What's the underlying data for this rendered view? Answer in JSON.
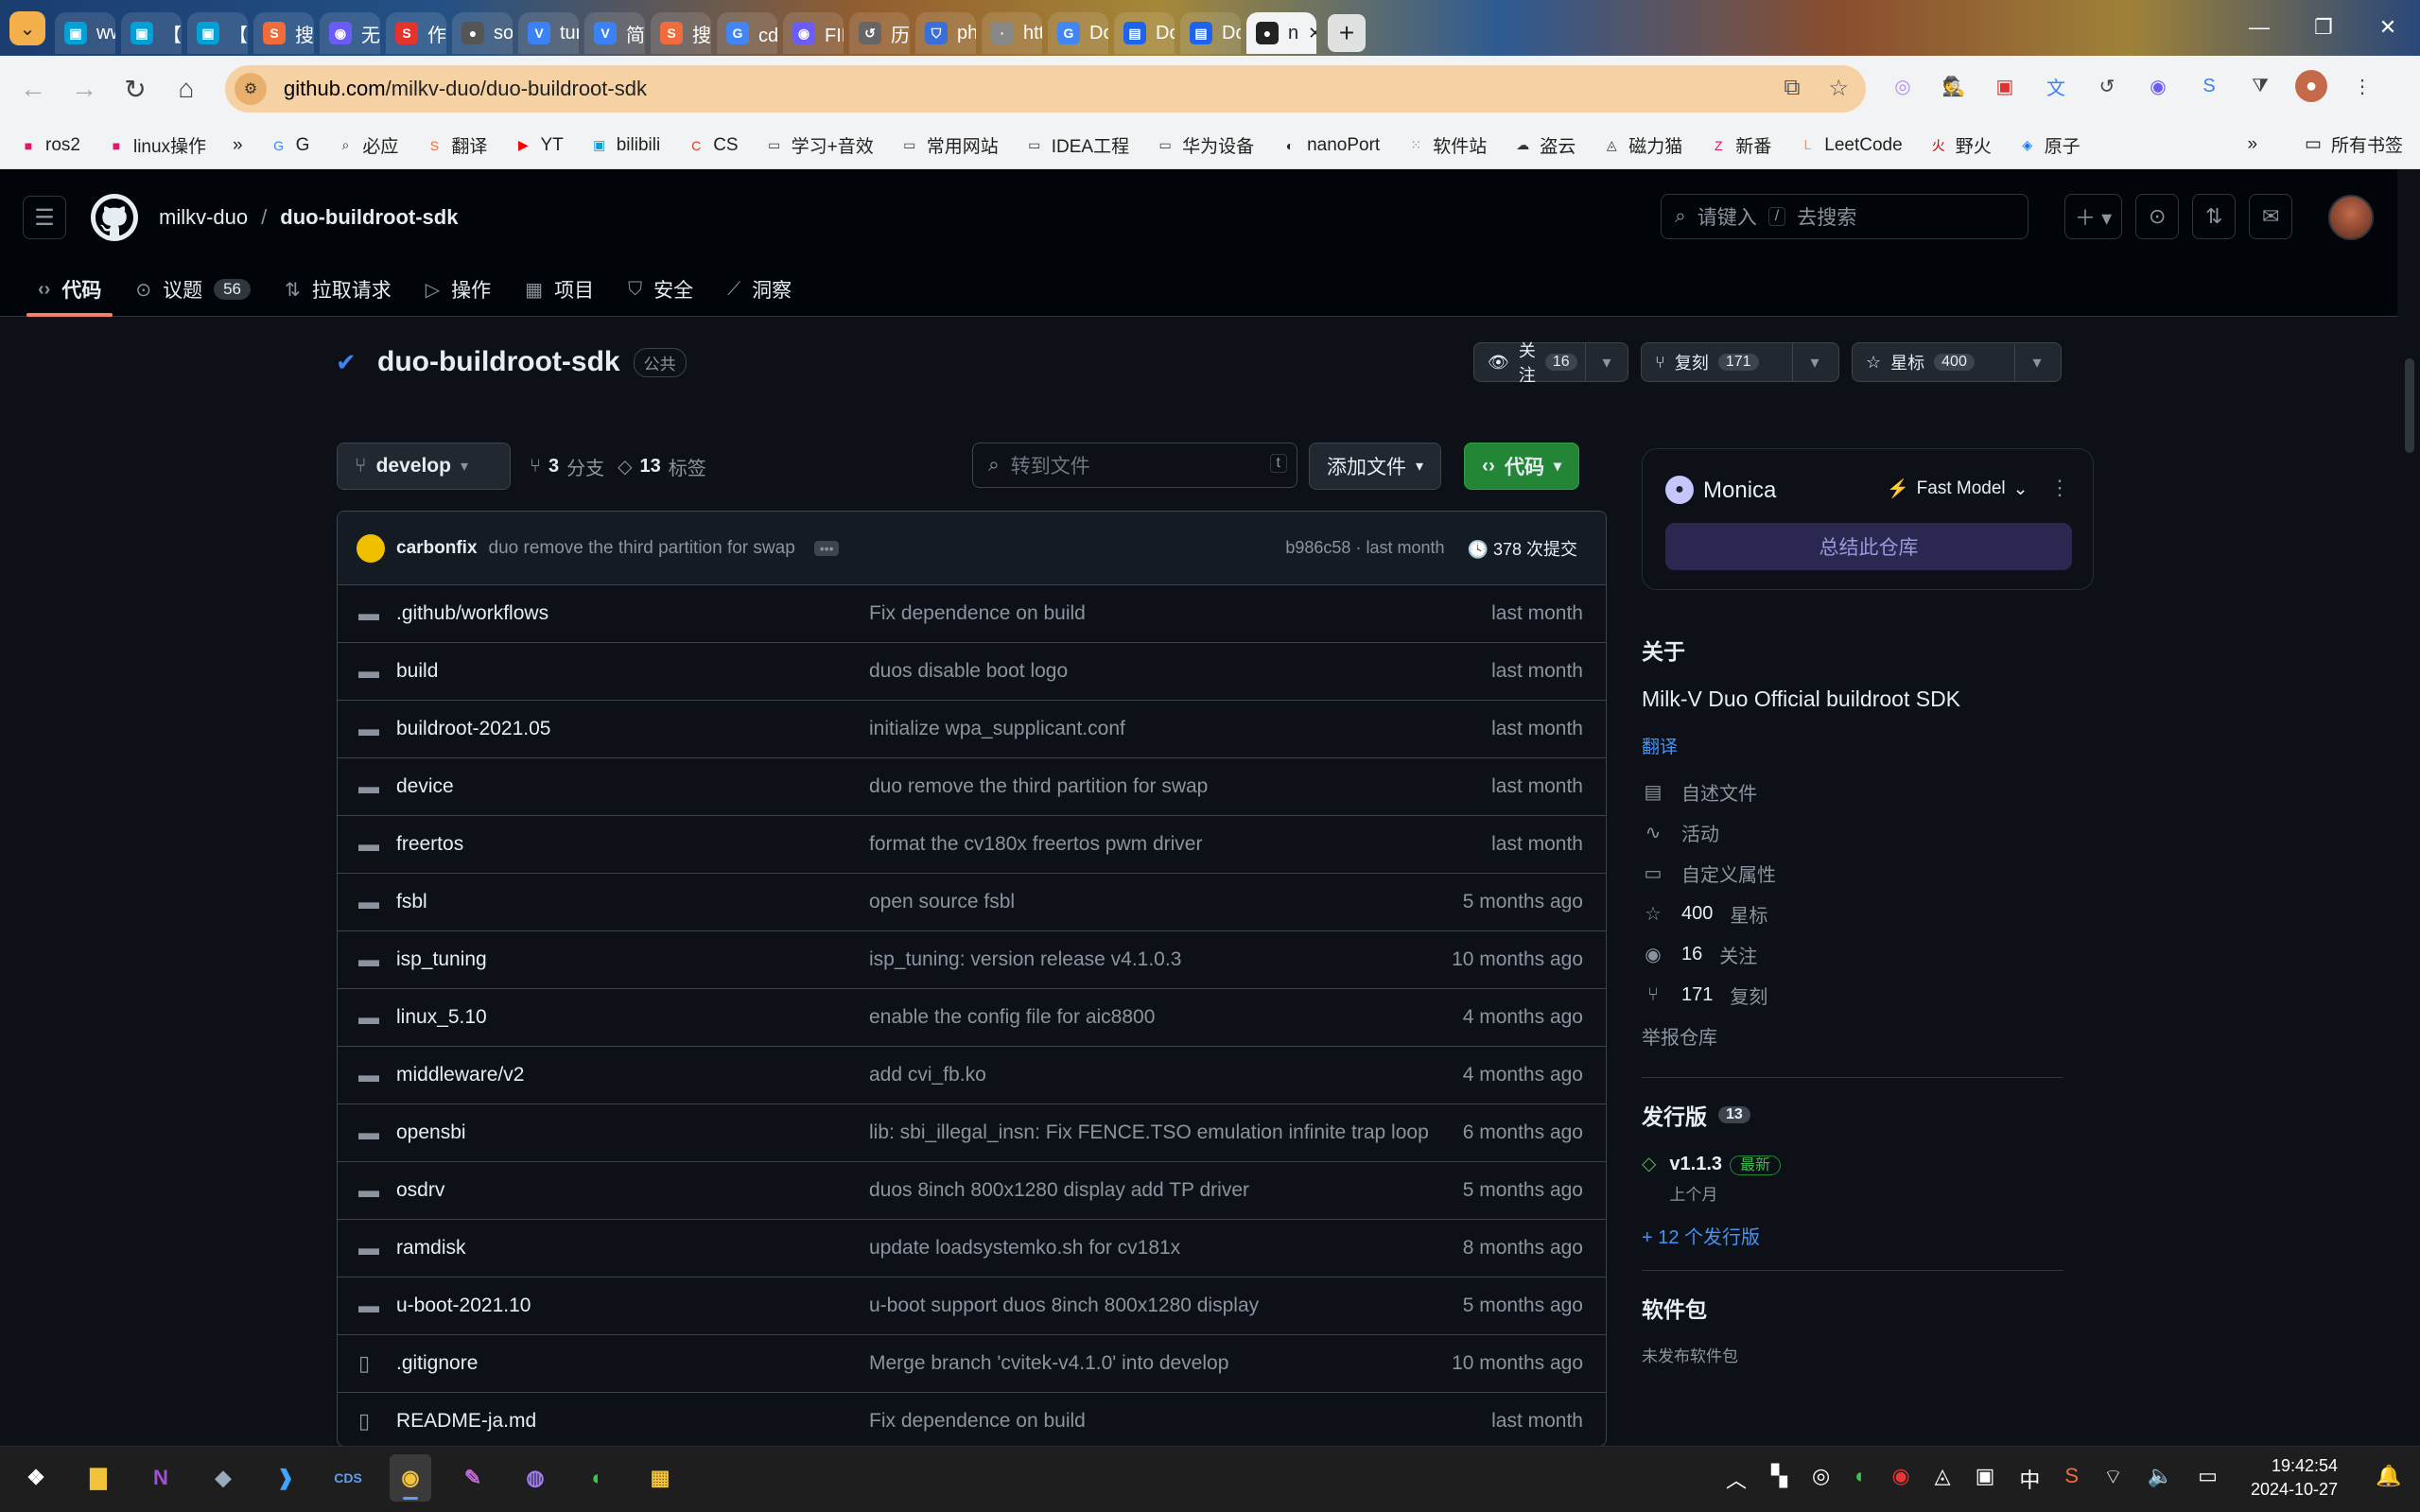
{
  "browser": {
    "tabs": [
      {
        "label": "www",
        "icon": "bilibili-tv-icon",
        "color": "#00a1d6"
      },
      {
        "label": "【全",
        "icon": "bilibili-tv-icon",
        "color": "#00a1d6"
      },
      {
        "label": "【官",
        "icon": "bilibili-tv-icon",
        "color": "#00a1d6"
      },
      {
        "label": "搜狗",
        "icon": "sogou-icon",
        "color": "#f26b3a"
      },
      {
        "label": "无法",
        "icon": "monica-icon",
        "color": "#6b5cf6"
      },
      {
        "label": "作为",
        "icon": "s-icon",
        "color": "#e5322d"
      },
      {
        "label": "soph",
        "icon": "github-icon",
        "color": "#555"
      },
      {
        "label": "tunin",
        "icon": "v-icon",
        "color": "#3b82f6"
      },
      {
        "label": "简介",
        "icon": "v-icon",
        "color": "#3b82f6"
      },
      {
        "label": "搜狗",
        "icon": "sogou-icon",
        "color": "#f26b3a"
      },
      {
        "label": "cds中",
        "icon": "google-icon",
        "color": "#4285f4"
      },
      {
        "label": "FIP图",
        "icon": "monica-icon",
        "color": "#6b5cf6"
      },
      {
        "label": "历史",
        "icon": "history-icon",
        "color": "#666"
      },
      {
        "label": "phjo",
        "icon": "shield-icon",
        "color": "#3b6fd8"
      },
      {
        "label": "https",
        "icon": "blank-icon",
        "color": "#888"
      },
      {
        "label": "Dock",
        "icon": "google-icon",
        "color": "#4285f4"
      },
      {
        "label": "Dock",
        "icon": "docker-icon",
        "color": "#1d63ed"
      },
      {
        "label": "Dock",
        "icon": "docker-icon",
        "color": "#1d63ed"
      },
      {
        "label": "n",
        "icon": "github-icon",
        "color": "#222",
        "active": true
      }
    ],
    "url_host": "github.com",
    "url_path": "/milkv-duo/duo-buildroot-sdk",
    "bookmarks": [
      {
        "label": "ros2",
        "icon": "bookmark-icon",
        "color": "#e3186d"
      },
      {
        "label": "linux操作",
        "icon": "bookmark-icon",
        "color": "#e3186d"
      },
      {
        "label": "G",
        "icon": "google-icon",
        "color": "#4285f4"
      },
      {
        "label": "必应",
        "icon": "search-icon",
        "color": "#333"
      },
      {
        "label": "翻译",
        "icon": "sogou-icon",
        "color": "#f26b3a"
      },
      {
        "label": "YT",
        "icon": "youtube-icon",
        "color": "#ff0000"
      },
      {
        "label": "bilibili",
        "icon": "bilibili-tv-icon",
        "color": "#00a1d6"
      },
      {
        "label": "CS",
        "icon": "c-icon",
        "color": "#e5322d"
      },
      {
        "label": "学习+音效",
        "icon": "folder-icon",
        "color": "#444"
      },
      {
        "label": "常用网站",
        "icon": "folder-icon",
        "color": "#444"
      },
      {
        "label": "IDEA工程",
        "icon": "folder-icon",
        "color": "#444"
      },
      {
        "label": "华为设备",
        "icon": "folder-icon",
        "color": "#444"
      },
      {
        "label": "nanoPort",
        "icon": "globe-icon",
        "color": "#222"
      },
      {
        "label": "软件站",
        "icon": "grid-icon",
        "color": "#888"
      },
      {
        "label": "盗云",
        "icon": "cloud-icon",
        "color": "#333"
      },
      {
        "label": "磁力猫",
        "icon": "cat-icon",
        "color": "#333"
      },
      {
        "label": "新番",
        "icon": "z-icon",
        "color": "#e3186d"
      },
      {
        "label": "LeetCode",
        "icon": "leetcode-icon",
        "color": "#f89f1b"
      },
      {
        "label": "野火",
        "icon": "fire-icon",
        "color": "#c00"
      },
      {
        "label": "原子",
        "icon": "atom-icon",
        "color": "#1a73e8"
      }
    ],
    "all_bookmarks_label": "所有书签"
  },
  "header": {
    "owner": "milkv-duo",
    "repo": "duo-buildroot-sdk",
    "search_prefix": "请键入",
    "search_key": "/",
    "search_suffix": "去搜索"
  },
  "repo_nav": [
    {
      "label": "代码",
      "icon": "code-icon",
      "active": true
    },
    {
      "label": "议题",
      "icon": "issue-icon",
      "count": "56"
    },
    {
      "label": "拉取请求",
      "icon": "pull-request-icon"
    },
    {
      "label": "操作",
      "icon": "play-icon"
    },
    {
      "label": "项目",
      "icon": "table-icon"
    },
    {
      "label": "安全",
      "icon": "shield-icon"
    },
    {
      "label": "洞察",
      "icon": "graph-icon"
    }
  ],
  "repo": {
    "name": "duo-buildroot-sdk",
    "visibility": "公共",
    "watch_label": "关注",
    "watch_count": "16",
    "fork_label": "复刻",
    "fork_count": "171",
    "star_label": "星标",
    "star_count": "400"
  },
  "toolbar": {
    "branch": "develop",
    "branches_count": "3",
    "branches_label": "分支",
    "tags_count": "13",
    "tags_label": "标签",
    "goto_placeholder": "转到文件",
    "goto_key": "t",
    "add_file_label": "添加文件",
    "code_label": "代码"
  },
  "commit": {
    "author": "carbonfix",
    "message": "duo remove the third partition for swap",
    "hash": "b986c58",
    "time": "last month",
    "commits_count": "378",
    "commits_label": "次提交"
  },
  "files": [
    {
      "type": "folder",
      "name": ".github/workflows",
      "message": "Fix dependence on build",
      "date": "last month"
    },
    {
      "type": "folder",
      "name": "build",
      "message": "duos disable boot logo",
      "date": "last month"
    },
    {
      "type": "folder",
      "name": "buildroot-2021.05",
      "message": "initialize wpa_supplicant.conf",
      "date": "last month"
    },
    {
      "type": "folder",
      "name": "device",
      "message": "duo remove the third partition for swap",
      "date": "last month"
    },
    {
      "type": "folder",
      "name": "freertos",
      "message": "format the cv180x freertos pwm driver",
      "date": "last month"
    },
    {
      "type": "folder",
      "name": "fsbl",
      "message": "open source fsbl",
      "date": "5 months ago"
    },
    {
      "type": "folder",
      "name": "isp_tuning",
      "message": "isp_tuning: version release v4.1.0.3",
      "date": "10 months ago"
    },
    {
      "type": "folder",
      "name": "linux_5.10",
      "message": "enable the config file for aic8800",
      "date": "4 months ago"
    },
    {
      "type": "folder",
      "name": "middleware/v2",
      "message": "add cvi_fb.ko",
      "date": "4 months ago"
    },
    {
      "type": "folder",
      "name": "opensbi",
      "message": "lib: sbi_illegal_insn: Fix FENCE.TSO emulation infinite trap loop",
      "date": "6 months ago"
    },
    {
      "type": "folder",
      "name": "osdrv",
      "message": "duos 8inch 800x1280 display add TP driver",
      "date": "5 months ago"
    },
    {
      "type": "folder",
      "name": "ramdisk",
      "message": "update loadsystemko.sh for cv181x",
      "date": "8 months ago"
    },
    {
      "type": "folder",
      "name": "u-boot-2021.10",
      "message": "u-boot support duos 8inch 800x1280 display",
      "date": "5 months ago"
    },
    {
      "type": "file",
      "name": ".gitignore",
      "message": "Merge branch 'cvitek-v4.1.0' into develop",
      "date": "10 months ago"
    },
    {
      "type": "file",
      "name": "README-ja.md",
      "message": "Fix dependence on build",
      "date": "last month"
    }
  ],
  "monica": {
    "name": "Monica",
    "model": "Fast Model",
    "summarize_label": "总结此仓库"
  },
  "about": {
    "heading": "关于",
    "description": "Milk-V Duo Official buildroot SDK",
    "translate": "翻译",
    "items": [
      {
        "icon": "book-icon",
        "label": "自述文件"
      },
      {
        "icon": "pulse-icon",
        "label": "活动"
      },
      {
        "icon": "note-icon",
        "label": "自定义属性"
      },
      {
        "icon": "star-icon",
        "count": "400",
        "label": "星标"
      },
      {
        "icon": "eye-icon",
        "count": "16",
        "label": "关注"
      },
      {
        "icon": "fork-icon",
        "count": "171",
        "label": "复刻"
      }
    ],
    "report": "举报仓库"
  },
  "releases": {
    "heading": "发行版",
    "count": "13",
    "latest_version": "v1.1.3",
    "latest_badge": "最新",
    "latest_time": "上个月",
    "more": "+ 12 个发行版"
  },
  "packages": {
    "heading": "软件包",
    "empty": "未发布软件包"
  },
  "taskbar": {
    "time": "19:42:54",
    "date": "2024-10-27",
    "ime": "中"
  }
}
